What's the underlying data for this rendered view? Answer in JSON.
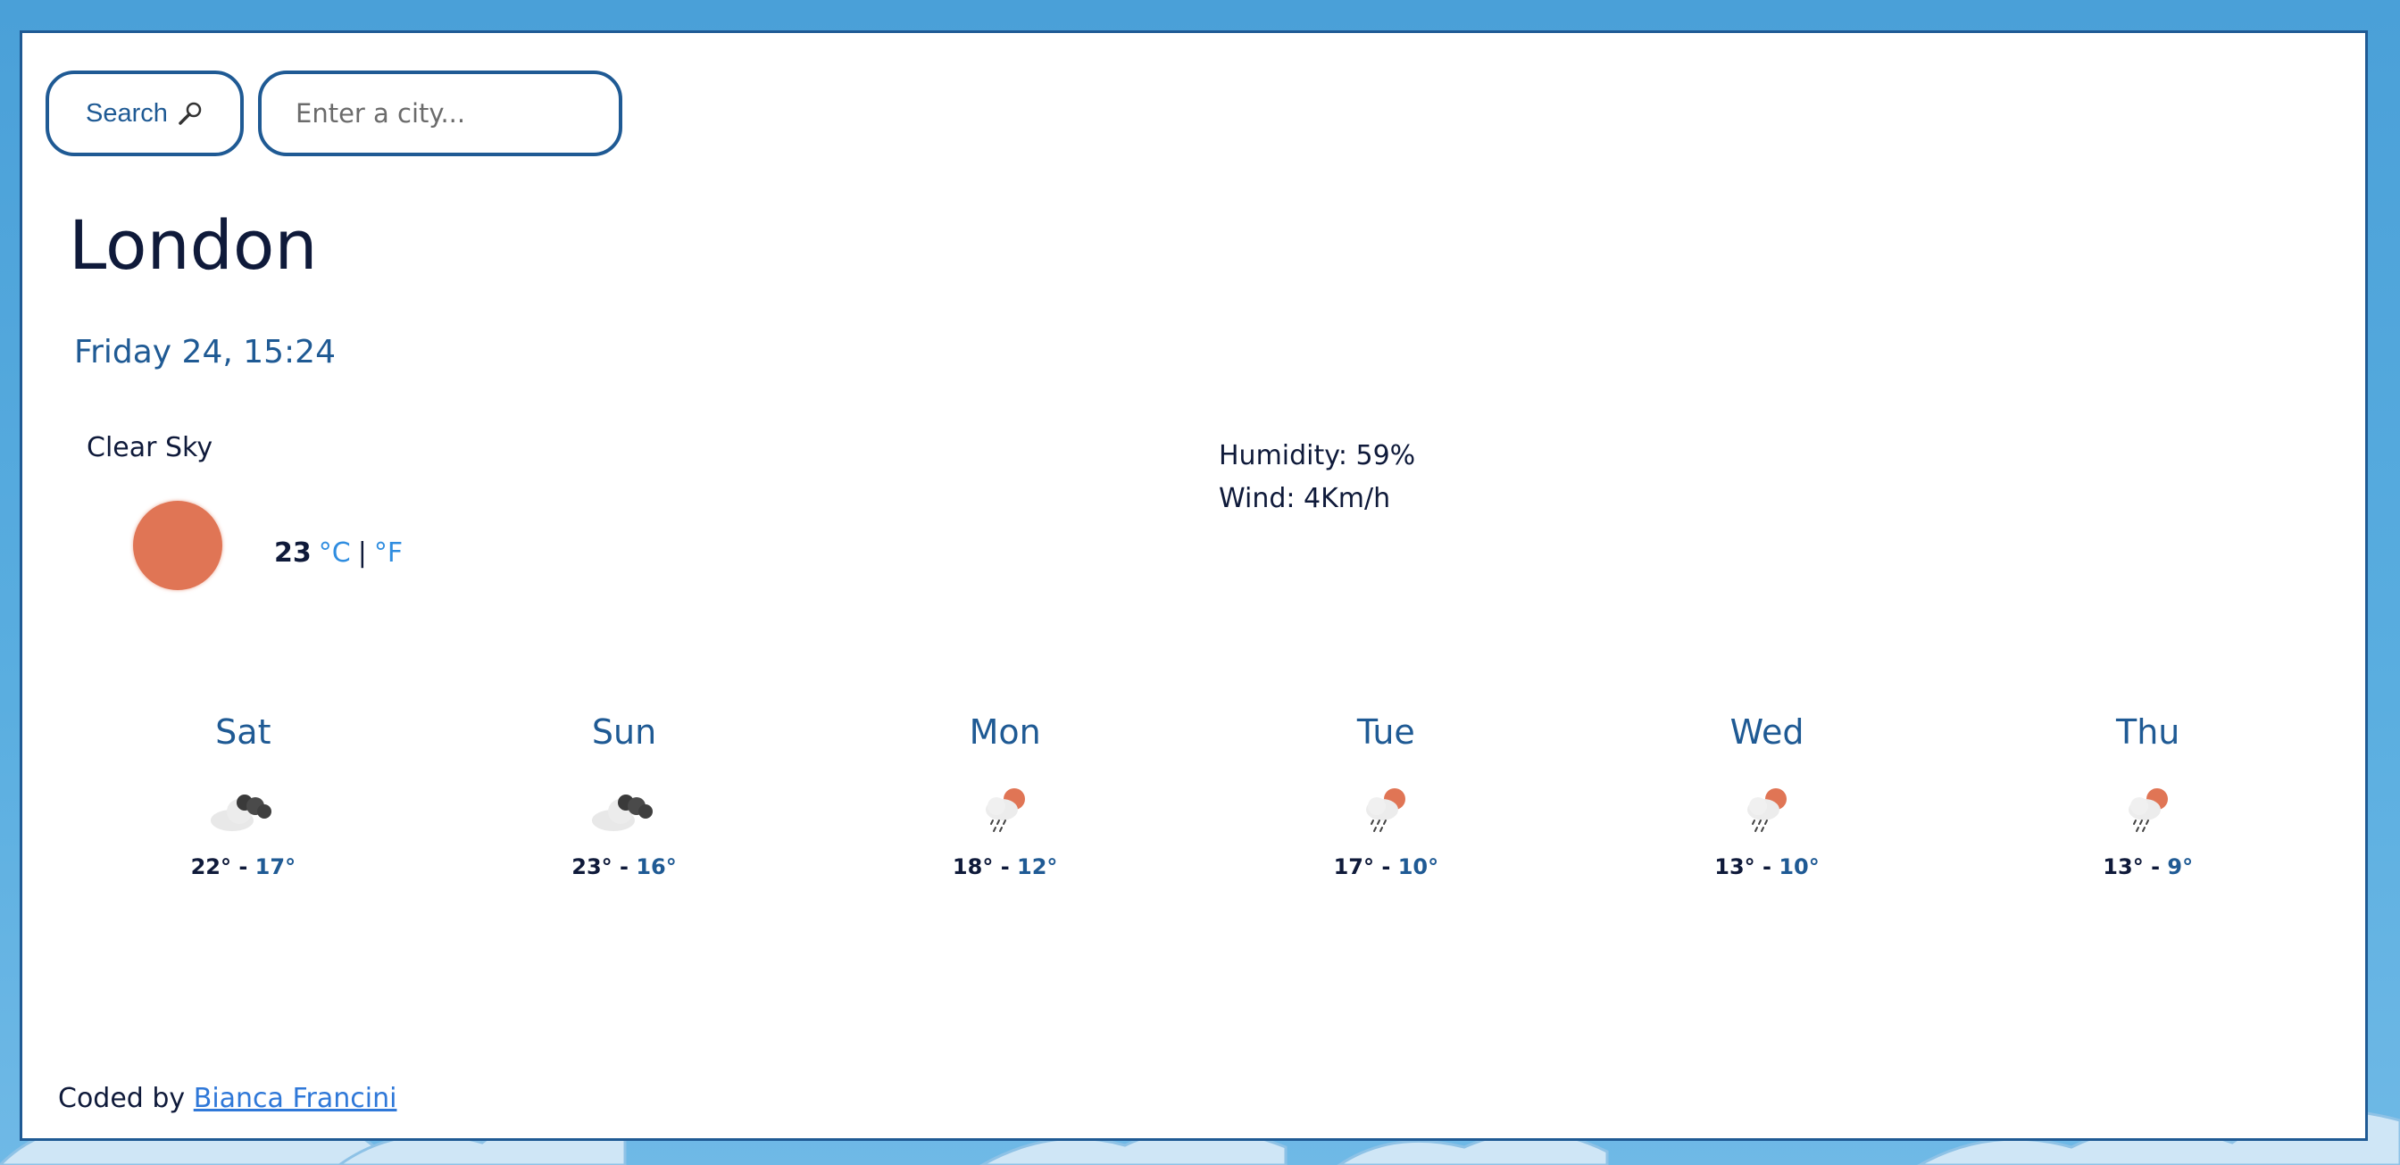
{
  "search": {
    "button_label": "Search",
    "button_icon": "magnifier-icon",
    "input_placeholder": "Enter a city...",
    "input_value": ""
  },
  "current": {
    "city": "London",
    "datetime": "Friday 24, 15:24",
    "description": "Clear Sky",
    "icon": "sun-icon",
    "temperature": "23",
    "unit_celsius": "°C",
    "unit_separator": "|",
    "unit_fahrenheit": "°F",
    "humidity": "Humidity: 59%",
    "wind": "Wind: 4Km/h"
  },
  "forecast": [
    {
      "day": "Sat",
      "icon": "dark-cloud-icon",
      "high": "22°",
      "sep": "-",
      "low": "17°"
    },
    {
      "day": "Sun",
      "icon": "dark-cloud-icon",
      "high": "23°",
      "sep": "-",
      "low": "16°"
    },
    {
      "day": "Mon",
      "icon": "sun-rain-cloud-icon",
      "high": "18°",
      "sep": "-",
      "low": "12°"
    },
    {
      "day": "Tue",
      "icon": "sun-rain-cloud-icon",
      "high": "17°",
      "sep": "-",
      "low": "10°"
    },
    {
      "day": "Wed",
      "icon": "sun-rain-cloud-icon",
      "high": "13°",
      "sep": "-",
      "low": "10°"
    },
    {
      "day": "Thu",
      "icon": "sun-rain-cloud-icon",
      "high": "13°",
      "sep": "-",
      "low": "9°"
    }
  ],
  "footer": {
    "prefix": "Coded by",
    "author_link": "Bianca Francini"
  },
  "colors": {
    "background": "#4aa0d8",
    "card_border": "#1f5a94",
    "accent_blue": "#1f5a94",
    "link_blue": "#2f8de0",
    "sun_orange": "#e07555",
    "text_dark": "#0f1a3a"
  }
}
